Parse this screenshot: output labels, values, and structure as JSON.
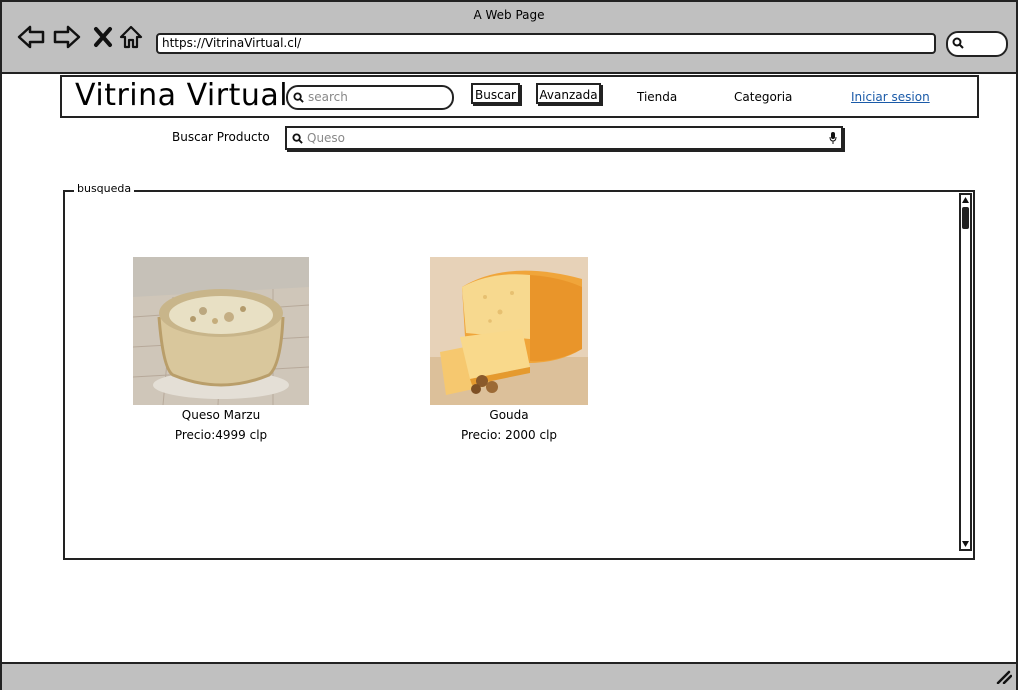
{
  "window": {
    "title": "A Web Page",
    "url": "https://VitrinaVirtual.cl/"
  },
  "header": {
    "brand": "Vitrina Virtual",
    "search_placeholder": "search",
    "buscar_label": "Buscar",
    "avanzada_label": "Avanzada",
    "tienda_label": "Tienda",
    "categoria_label": "Categoria",
    "login_label": "Iniciar sesion"
  },
  "search": {
    "label": "Buscar Producto",
    "value": "Queso"
  },
  "results": {
    "legend": "busqueda",
    "products": [
      {
        "name": "Queso Marzu",
        "price": "Precio:4999 clp"
      },
      {
        "name": "Gouda",
        "price": "Precio: 2000 clp"
      }
    ]
  },
  "colors": {
    "chrome": "#c0c0c0",
    "link": "#1a5aa8",
    "border": "#222222"
  }
}
